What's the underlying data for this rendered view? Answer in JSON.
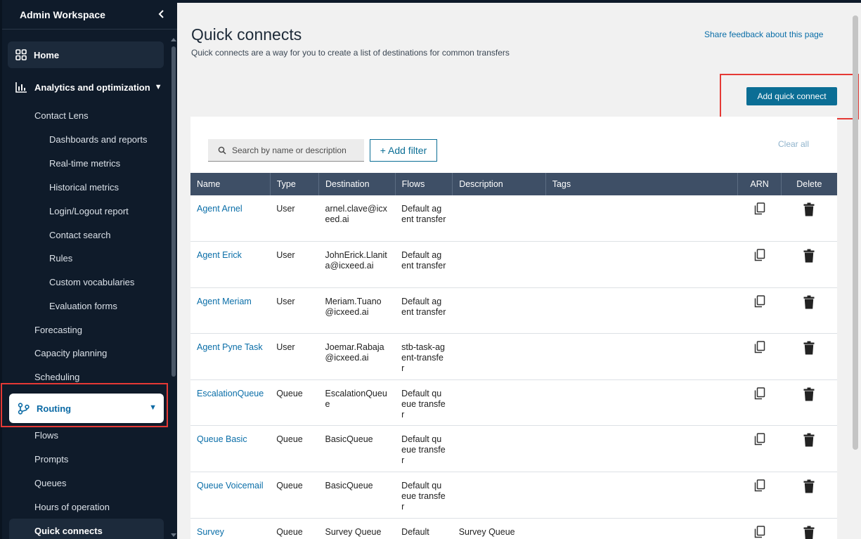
{
  "sidebar": {
    "title": "Admin Workspace",
    "home": "Home",
    "analytics": "Analytics and optimization",
    "contact_lens": "Contact Lens",
    "contact_lens_items": [
      "Dashboards and reports",
      "Real-time metrics",
      "Historical metrics",
      "Login/Logout report",
      "Contact search",
      "Rules",
      "Custom vocabularies",
      "Evaluation forms"
    ],
    "forecasting": "Forecasting",
    "capacity_planning": "Capacity planning",
    "scheduling": "Scheduling",
    "routing": "Routing",
    "routing_items": [
      "Flows",
      "Prompts",
      "Queues",
      "Hours of operation"
    ],
    "active_item": "Quick connects"
  },
  "page": {
    "title": "Quick connects",
    "subtitle": "Quick connects are a way for you to create a list of destinations for common transfers",
    "feedback": "Share feedback about this page",
    "add_button": "Add quick connect",
    "search_placeholder": "Search by name or description",
    "add_filter": "+ Add filter",
    "clear_all": "Clear all"
  },
  "table": {
    "headers": [
      "Name",
      "Type",
      "Destination",
      "Flows",
      "Description",
      "Tags",
      "ARN",
      "Delete"
    ],
    "rows": [
      {
        "name": "Agent Arnel",
        "type": "User",
        "destination": "arnel.clave@icxeed.ai",
        "flows": "Default agent transfer",
        "description": "",
        "tags": ""
      },
      {
        "name": "Agent Erick",
        "type": "User",
        "destination": "JohnErick.Llanita@icxeed.ai",
        "flows": "Default agent transfer",
        "description": "",
        "tags": ""
      },
      {
        "name": "Agent Meriam",
        "type": "User",
        "destination": "Meriam.Tuano@icxeed.ai",
        "flows": "Default agent transfer",
        "description": "",
        "tags": ""
      },
      {
        "name": "Agent Pyne Task",
        "type": "User",
        "destination": "Joemar.Rabaja@icxeed.ai",
        "flows": "stb-task-agent-transfer",
        "description": "",
        "tags": ""
      },
      {
        "name": "EscalationQueue",
        "type": "Queue",
        "destination": "EscalationQueue",
        "flows": "Default queue transfer",
        "description": "",
        "tags": ""
      },
      {
        "name": "Queue Basic",
        "type": "Queue",
        "destination": "BasicQueue",
        "flows": "Default queue transfer",
        "description": "",
        "tags": ""
      },
      {
        "name": "Queue Voicemail",
        "type": "Queue",
        "destination": "BasicQueue",
        "flows": "Default queue transfer",
        "description": "",
        "tags": ""
      },
      {
        "name": "Survey",
        "type": "Queue",
        "destination": "Survey Queue",
        "flows": "Default",
        "description": "Survey Queue",
        "tags": ""
      }
    ]
  },
  "colors": {
    "sidebar_bg": "#0f1b2a",
    "accent": "#0b6e95",
    "link": "#0a6ea8",
    "table_header": "#3e4f66",
    "highlight": "#e53935"
  }
}
